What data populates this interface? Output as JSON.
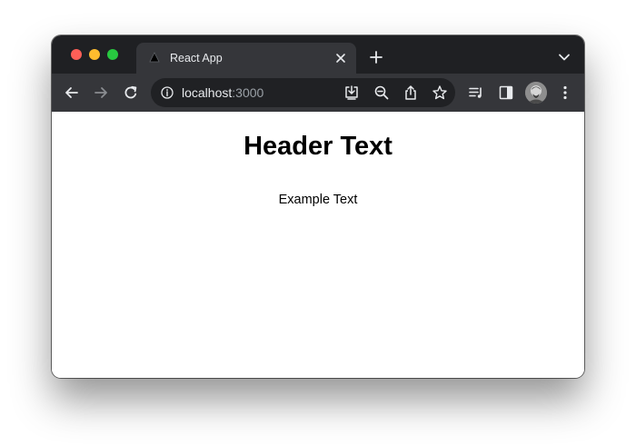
{
  "browser": {
    "tab": {
      "title": "React App",
      "favicon": "triangle-favicon-icon",
      "close_icon": "close-icon"
    },
    "new_tab_icon": "plus-icon",
    "tab_search_icon": "chevron-down-icon",
    "toolbar": {
      "back_icon": "arrow-left-icon",
      "forward_icon": "arrow-right-icon",
      "reload_icon": "reload-icon",
      "url_host": "localhost",
      "url_port": ":3000",
      "site_info_icon": "info-icon",
      "omnibox_actions": [
        "install-icon",
        "zoom-out-icon",
        "share-icon",
        "star-icon"
      ],
      "extra_actions": [
        "reading-list-icon",
        "side-panel-icon",
        "avatar",
        "kebab-menu-icon"
      ]
    },
    "colors": {
      "tabstrip": "#1f2023",
      "toolbar": "#35363a",
      "omnibox": "#202124",
      "text": "#e8eaed",
      "muted": "#9aa0a6",
      "close_red": "#ff5f57",
      "minimize_yellow": "#febc2e",
      "zoom_green": "#28c840"
    }
  },
  "page": {
    "header": "Header Text",
    "body": "Example Text"
  }
}
